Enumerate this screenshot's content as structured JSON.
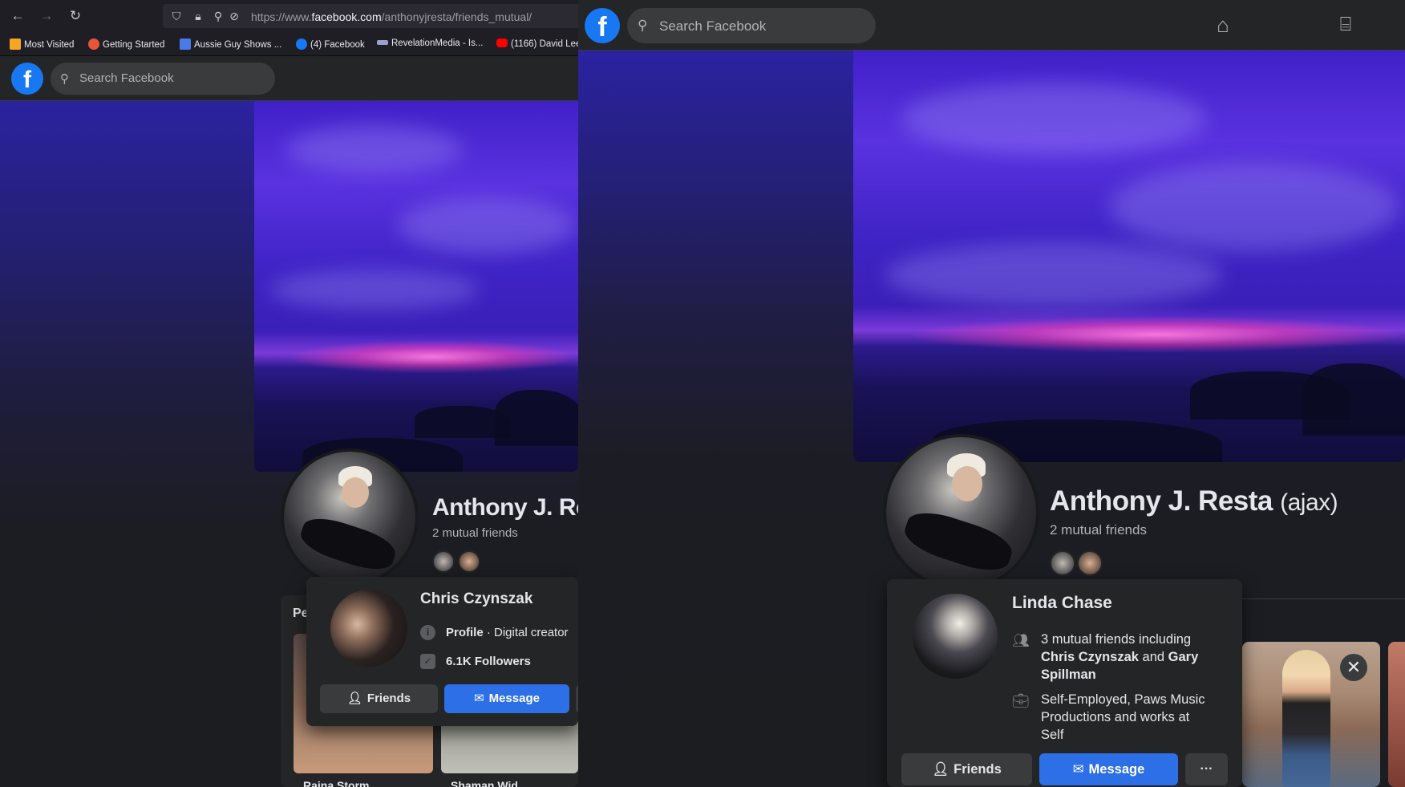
{
  "left": {
    "browser": {
      "url_prefix": "https://www.",
      "url_domain": "facebook.com",
      "url_path": "/anthonyjresta/friends_mutual/",
      "bookmarks": [
        {
          "label": "Most Visited",
          "icon": "gear-icon",
          "color": "#f5a623"
        },
        {
          "label": "Getting Started",
          "icon": "firefox-icon",
          "color": "#e8563a"
        },
        {
          "label": "Aussie Guy Shows ...",
          "icon": "bookmark-icon",
          "color": "#4a7ae8"
        },
        {
          "label": "(4) Facebook",
          "icon": "facebook-icon",
          "color": "#1877f2"
        },
        {
          "label": "RevelationMedia - Is...",
          "icon": "rm-icon",
          "color": "#9aa0c8"
        },
        {
          "label": "(1166) David Lee",
          "icon": "youtube-icon",
          "color": "#ff0000"
        }
      ]
    },
    "search_placeholder": "Search Facebook",
    "profile": {
      "name": "Anthony J. Re",
      "mutual": "2 mutual friends"
    },
    "people_label": "Pe",
    "thumbs": [
      {
        "name": "Raina Storm"
      },
      {
        "name": "Shaman Wid"
      }
    ],
    "hover_card": {
      "name": "Chris Czynszak",
      "profile_bold": "Profile",
      "profile_rest": " · Digital creator",
      "followers": "6.1K Followers",
      "friends_btn": "Friends",
      "message_btn": "Message"
    }
  },
  "right": {
    "search_placeholder": "Search Facebook",
    "profile": {
      "name": "Anthony J. Resta",
      "alt_name": "(ajax)",
      "mutual": "2 mutual friends"
    },
    "hover_card": {
      "name": "Linda Chase",
      "mutual_prefix": "3 mutual friends including ",
      "mutual_a": "Chris Czynszak",
      "mutual_and": " and ",
      "mutual_b": "Gary Spillman",
      "work": "Self-Employed, Paws Music Productions and works at Self",
      "friends_btn": "Friends",
      "message_btn": "Message",
      "more_btn": "···"
    },
    "close_label": "✕"
  },
  "colors": {
    "fb_blue": "#1877f2",
    "message_blue": "#2d6fe6",
    "surface": "#242526"
  }
}
